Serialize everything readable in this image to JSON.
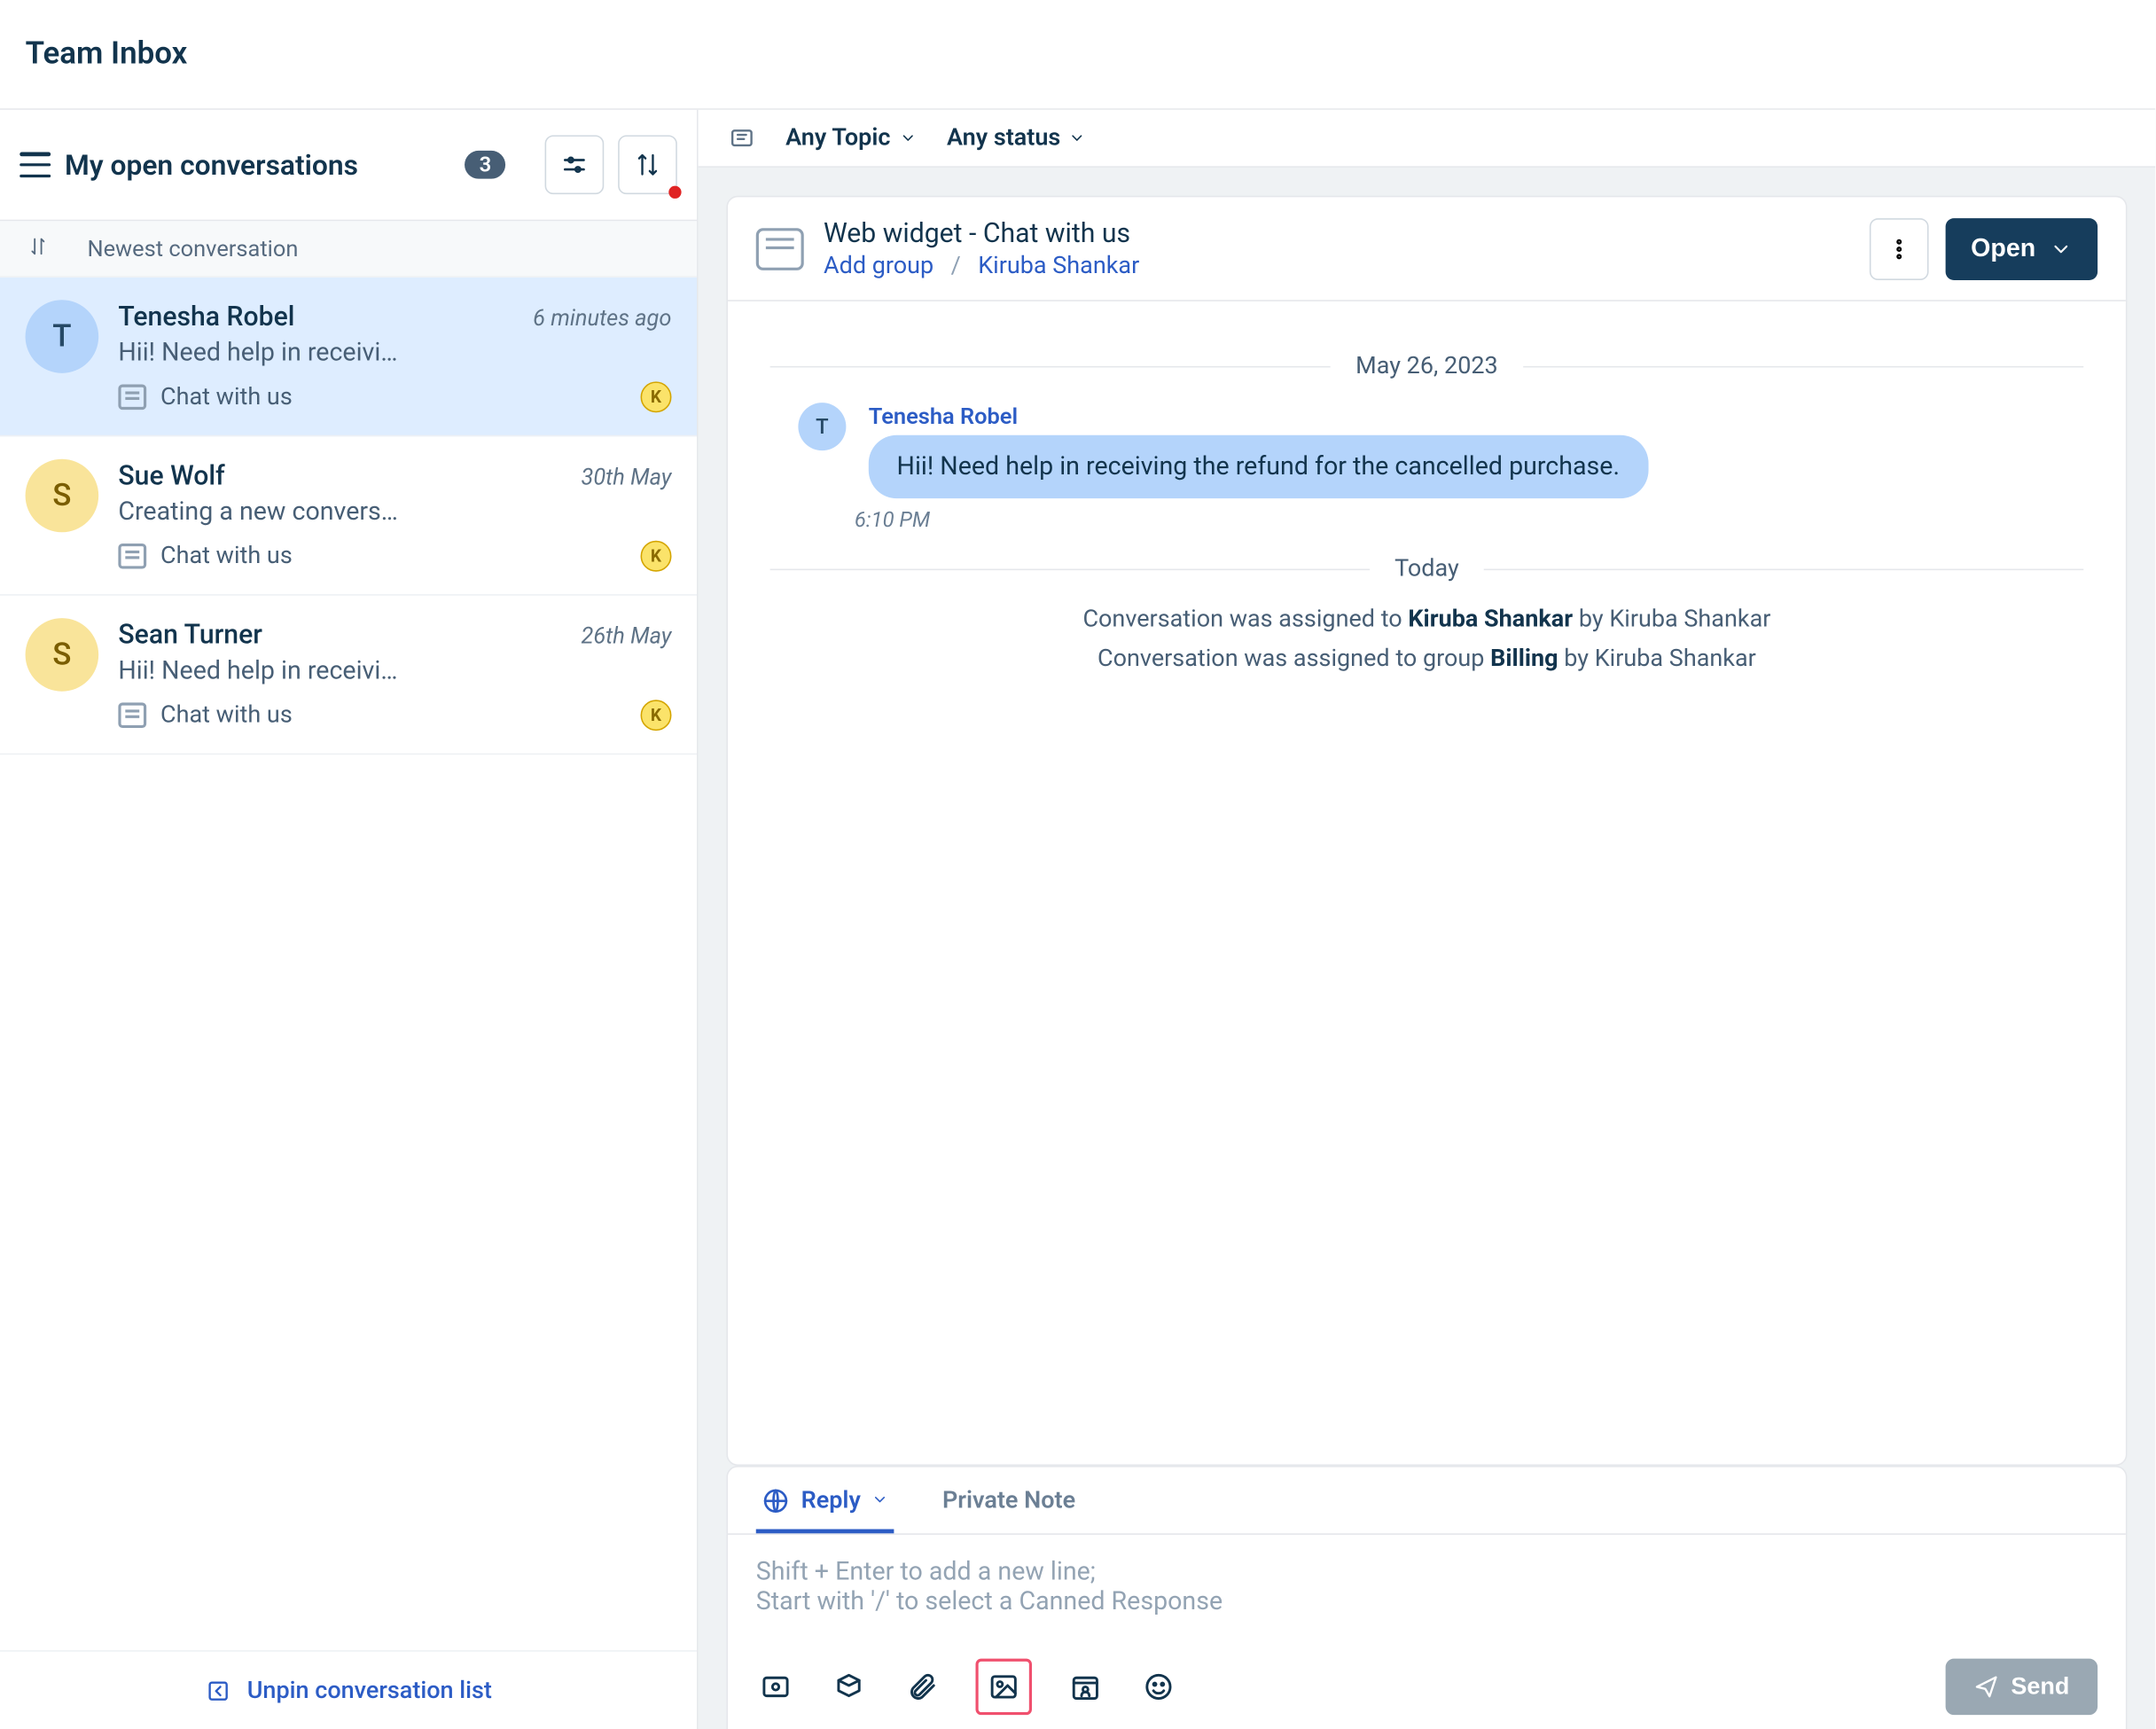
{
  "header": {
    "title": "Team Inbox"
  },
  "sidebar": {
    "title": "My open conversations",
    "count": "3",
    "sort_label": "Newest conversation",
    "unpin_label": "Unpin conversation list",
    "items": [
      {
        "name": "Tenesha Robel",
        "time": "6 minutes ago",
        "preview": "Hii! Need help in receivi…",
        "source": "Chat with us",
        "initial": "T",
        "avatar_color": "blue",
        "selected": true,
        "assignee_badge": "K"
      },
      {
        "name": "Sue Wolf",
        "time": "30th May",
        "preview": "Creating a new convers…",
        "source": "Chat with us",
        "initial": "S",
        "avatar_color": "yellow",
        "selected": false,
        "assignee_badge": "K"
      },
      {
        "name": "Sean Turner",
        "time": "26th May",
        "preview": "Hii! Need help in receivi…",
        "source": "Chat with us",
        "initial": "S",
        "avatar_color": "yellow",
        "selected": false,
        "assignee_badge": "K"
      }
    ]
  },
  "filters": {
    "topic": "Any Topic",
    "status": "Any status"
  },
  "conversation": {
    "channel_label": "Web widget - Chat with us",
    "group_action": "Add group",
    "assignee": "Kiruba Shankar",
    "status_button": "Open",
    "date1": "May 26, 2023",
    "message": {
      "sender": "Tenesha Robel",
      "initial": "T",
      "text": "Hii! Need help in receiving the refund for the cancelled purchase.",
      "time": "6:10 PM"
    },
    "date2": "Today",
    "system1_pre": "Conversation was assigned to ",
    "system1_bold": "Kiruba Shankar",
    "system1_post": " by Kiruba Shankar",
    "system2_pre": "Conversation was assigned to group ",
    "system2_bold": "Billing",
    "system2_post": " by Kiruba Shankar"
  },
  "editor": {
    "tab_reply": "Reply",
    "tab_note": "Private Note",
    "placeholder_line1": "Shift + Enter to add a new line;",
    "placeholder_line2": "Start with '/' to select a Canned Response",
    "send": "Send"
  }
}
